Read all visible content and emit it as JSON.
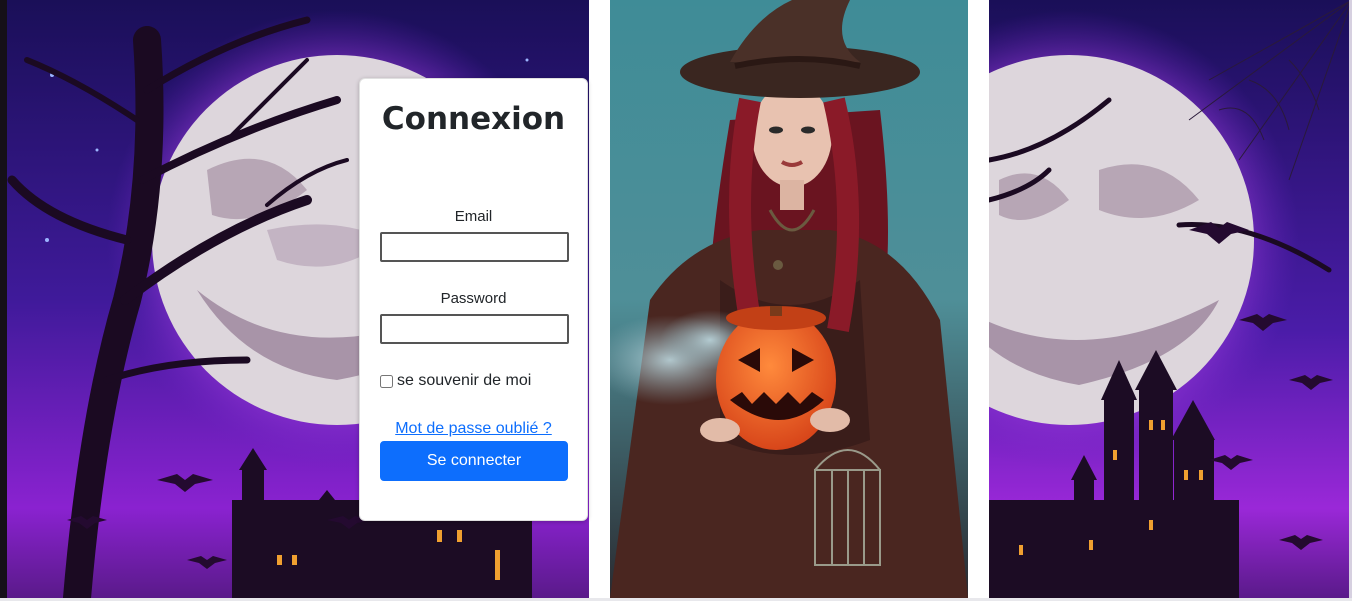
{
  "login": {
    "title": "Connexion",
    "email_label": "Email",
    "email_value": "",
    "password_label": "Password",
    "password_value": "",
    "remember_label": "se souvenir de moi",
    "remember_checked": false,
    "forgot_label": "Mot de passe oublié ?",
    "submit_label": "Se connecter"
  },
  "colors": {
    "accent": "#0d6efd",
    "night_purple": "#5a1fb0",
    "moon": "#ddd6dc",
    "pumpkin": "#f06a28"
  },
  "images": {
    "left_background": "halloween-moon-night-image",
    "center_picture": "witch-with-pumpkin-image",
    "right_background": "halloween-moon-castle-image"
  }
}
